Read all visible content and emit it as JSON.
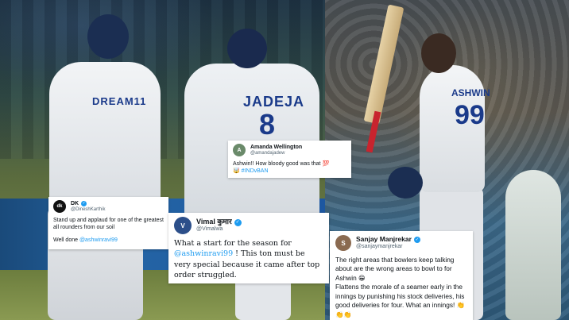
{
  "colors": {
    "link": "#1d9bf0",
    "verified": "#1d9bf0",
    "text": "#0f1419",
    "muted": "#536471"
  },
  "photo": {
    "left_jersey_text": "DREAM11",
    "jadeja_name": "JADEJA",
    "jadeja_number": "8",
    "ashwin_name": "ASHWIN",
    "ashwin_number": "99"
  },
  "tweets": {
    "amanda": {
      "display_name": "Amanda Wellington",
      "handle": "@amandajadew",
      "avatar_initial": "A",
      "text": "Ashwin!! How bloody good was that 💯",
      "line2_emoji": "🤯",
      "hashtag": "#INDvBAN"
    },
    "dk": {
      "display_name": "DK",
      "handle": "@DineshKarthik",
      "avatar_initial": "dk",
      "line1": "Stand up and applaud for one of the greatest all rounders from our soil",
      "line2_prefix": "Well done ",
      "mention": "@ashwinravi99"
    },
    "vimal": {
      "display_name": "Vimal कुमार",
      "handle": "@Vimalwa",
      "avatar_initial": "V",
      "line1": "What a start for the season for",
      "mention": "@ashwinravi99",
      "line2": " ! This ton must be very special because it came after top order struggled."
    },
    "sanjay": {
      "display_name": "Sanjay Manjrekar",
      "handle": "@sanjaymanjrekar",
      "avatar_initial": "S",
      "para1": "The right areas that bowlers keep talking about are the wrong areas to bowl to for Ashwin 😁",
      "para2": "Flattens the morale of a seamer early in the innings by punishing his stock deliveries, his good deliveries for four. What an innings! 👏👏👏"
    }
  }
}
